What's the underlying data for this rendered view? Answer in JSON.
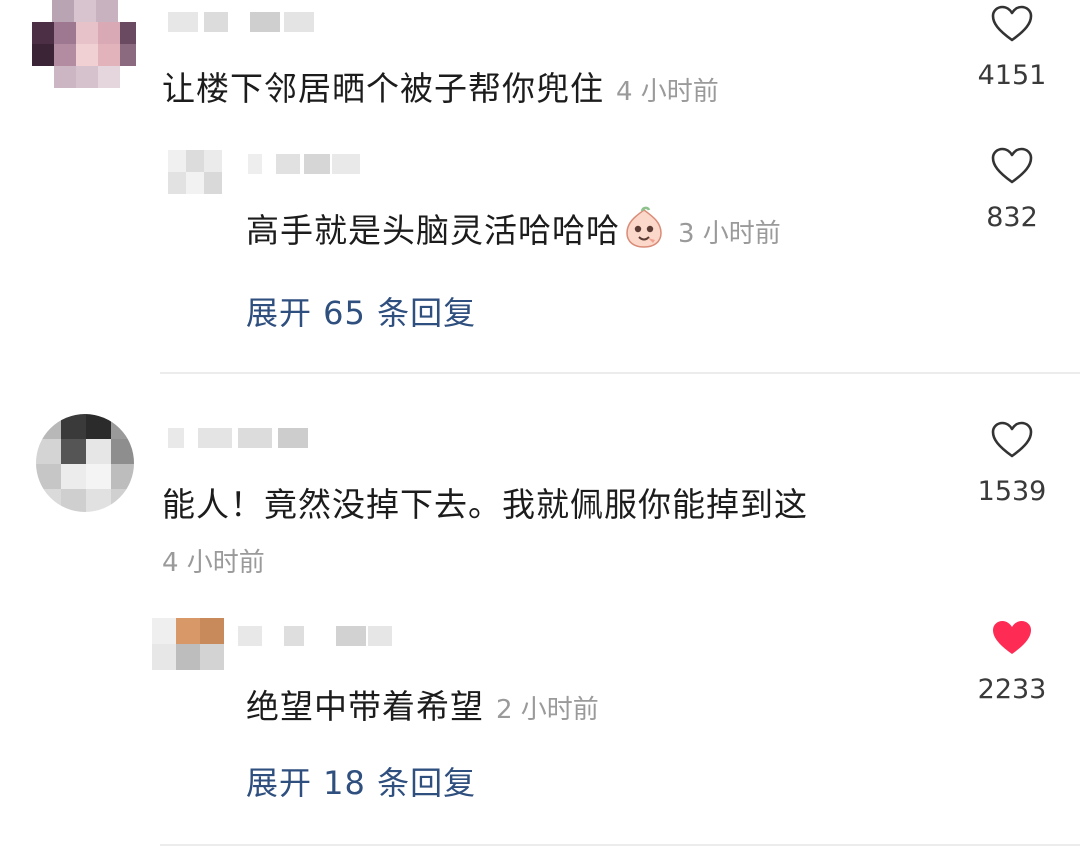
{
  "comments": [
    {
      "text": "让楼下邻居晒个被子帮你兜住",
      "time": "4 小时前",
      "likes": "4151",
      "liked": false,
      "reply": {
        "text": "高手就是头脑灵活哈哈哈",
        "time": "3 小时前",
        "likes": "832",
        "liked": false
      },
      "expand_label": "展开 65 条回复"
    },
    {
      "text": "能人！竟然没掉下去。我就佩服你能掉到这",
      "time": "4 小时前",
      "likes": "1539",
      "liked": false,
      "reply": {
        "text": "绝望中带着希望",
        "time": "2 小时前",
        "likes": "2233",
        "liked": true
      },
      "expand_label": "展开 18 条回复"
    }
  ],
  "colors": {
    "like_outline": "#333333",
    "like_active": "#fe2c55",
    "expand_link": "#2f4f7f",
    "timestamp": "#9a9a9a"
  },
  "icons": {
    "like": "heart-outline-icon",
    "like_active": "heart-filled-icon",
    "reply_emoji": "laughing-emoji-icon"
  }
}
